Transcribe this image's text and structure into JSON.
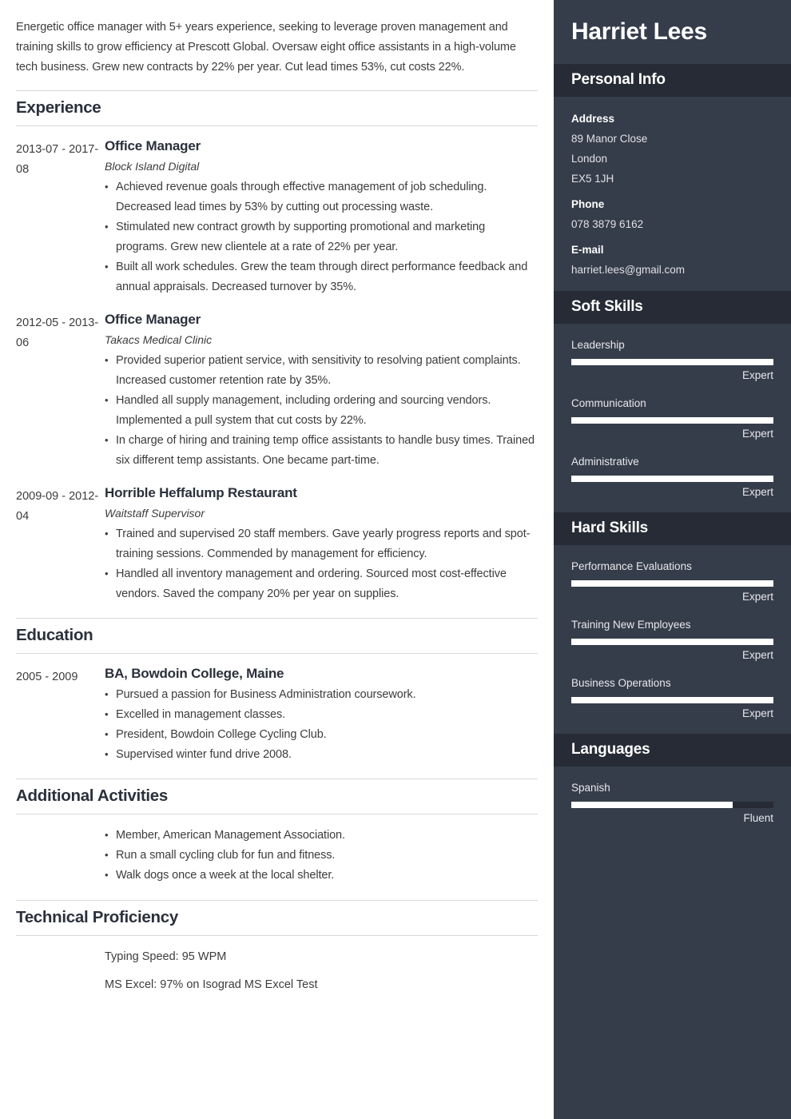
{
  "summary": "Energetic office manager with 5+ years experience, seeking to leverage proven management and training skills to grow efficiency at Prescott Global. Oversaw eight office assistants in a high-volume tech business. Grew new contracts by 22% per year. Cut lead times 53%, cut costs 22%.",
  "sections": {
    "experience": {
      "title": "Experience",
      "entries": [
        {
          "dates": "2013-07 - 2017-08",
          "title": "Office Manager",
          "subtitle": "Block Island Digital",
          "bullets": [
            "Achieved revenue goals through effective management of job scheduling. Decreased lead times by 53% by cutting out processing waste.",
            "Stimulated new contract growth by supporting promotional and marketing programs. Grew new clientele at a rate of 22% per year.",
            "Built all work schedules. Grew the team through direct performance feedback and annual appraisals. Decreased turnover by 35%."
          ]
        },
        {
          "dates": "2012-05 - 2013-06",
          "title": "Office Manager",
          "subtitle": "Takacs Medical Clinic",
          "bullets": [
            "Provided superior patient service, with sensitivity to resolving patient complaints. Increased customer retention rate by 35%.",
            "Handled all supply management, including ordering and sourcing vendors. Implemented a pull system that cut costs by 22%.",
            "In charge of hiring and training temp office assistants to handle busy times. Trained six different temp assistants. One became part-time."
          ]
        },
        {
          "dates": "2009-09 - 2012-04",
          "title": "Horrible Heffalump Restaurant",
          "subtitle": "Waitstaff Supervisor",
          "bullets": [
            "Trained and supervised 20 staff members. Gave yearly progress reports and spot-training sessions. Commended by management for efficiency.",
            "Handled all inventory management and ordering. Sourced most cost-effective vendors. Saved the company 20% per year on supplies."
          ]
        }
      ]
    },
    "education": {
      "title": "Education",
      "entries": [
        {
          "dates": "2005 - 2009",
          "title": "BA, Bowdoin College, Maine",
          "bullets": [
            "Pursued a passion for Business Administration coursework.",
            "Excelled in management classes.",
            "President, Bowdoin College Cycling Club.",
            "Supervised winter fund drive 2008."
          ]
        }
      ]
    },
    "additional_activities": {
      "title": "Additional Activities",
      "bullets": [
        "Member, American Management Association.",
        "Run a small cycling club for fun and fitness.",
        "Walk dogs once a week at the local shelter."
      ]
    },
    "technical_proficiency": {
      "title": "Technical Proficiency",
      "lines": [
        "Typing Speed: 95 WPM",
        "MS Excel: 97% on Isograd MS Excel Test"
      ]
    }
  },
  "sidebar": {
    "name": "Harriet Lees",
    "personal_info": {
      "title": "Personal Info",
      "groups": [
        {
          "label": "Address",
          "values": [
            "89 Manor Close",
            "London",
            "EX5 1JH"
          ]
        },
        {
          "label": "Phone",
          "values": [
            "078 3879 6162"
          ]
        },
        {
          "label": "E-mail",
          "values": [
            "harriet.lees@gmail.com"
          ]
        }
      ]
    },
    "soft_skills": {
      "title": "Soft Skills",
      "items": [
        {
          "name": "Leadership",
          "level": "Expert",
          "percent": 100
        },
        {
          "name": "Communication",
          "level": "Expert",
          "percent": 100
        },
        {
          "name": "Administrative",
          "level": "Expert",
          "percent": 100
        }
      ]
    },
    "hard_skills": {
      "title": "Hard Skills",
      "items": [
        {
          "name": "Performance Evaluations",
          "level": "Expert",
          "percent": 100
        },
        {
          "name": "Training New Employees",
          "level": "Expert",
          "percent": 100
        },
        {
          "name": "Business Operations",
          "level": "Expert",
          "percent": 100
        }
      ]
    },
    "languages": {
      "title": "Languages",
      "items": [
        {
          "name": "Spanish",
          "level": "Fluent",
          "percent": 80
        }
      ]
    }
  },
  "colors": {
    "sidebar_bg": "#363d4a",
    "sidebar_header_bg": "#262b35",
    "text_dark": "#2b303b",
    "text_body": "#3c3c3c",
    "rule": "#d8d8d8",
    "bar_fill": "#ffffff"
  }
}
